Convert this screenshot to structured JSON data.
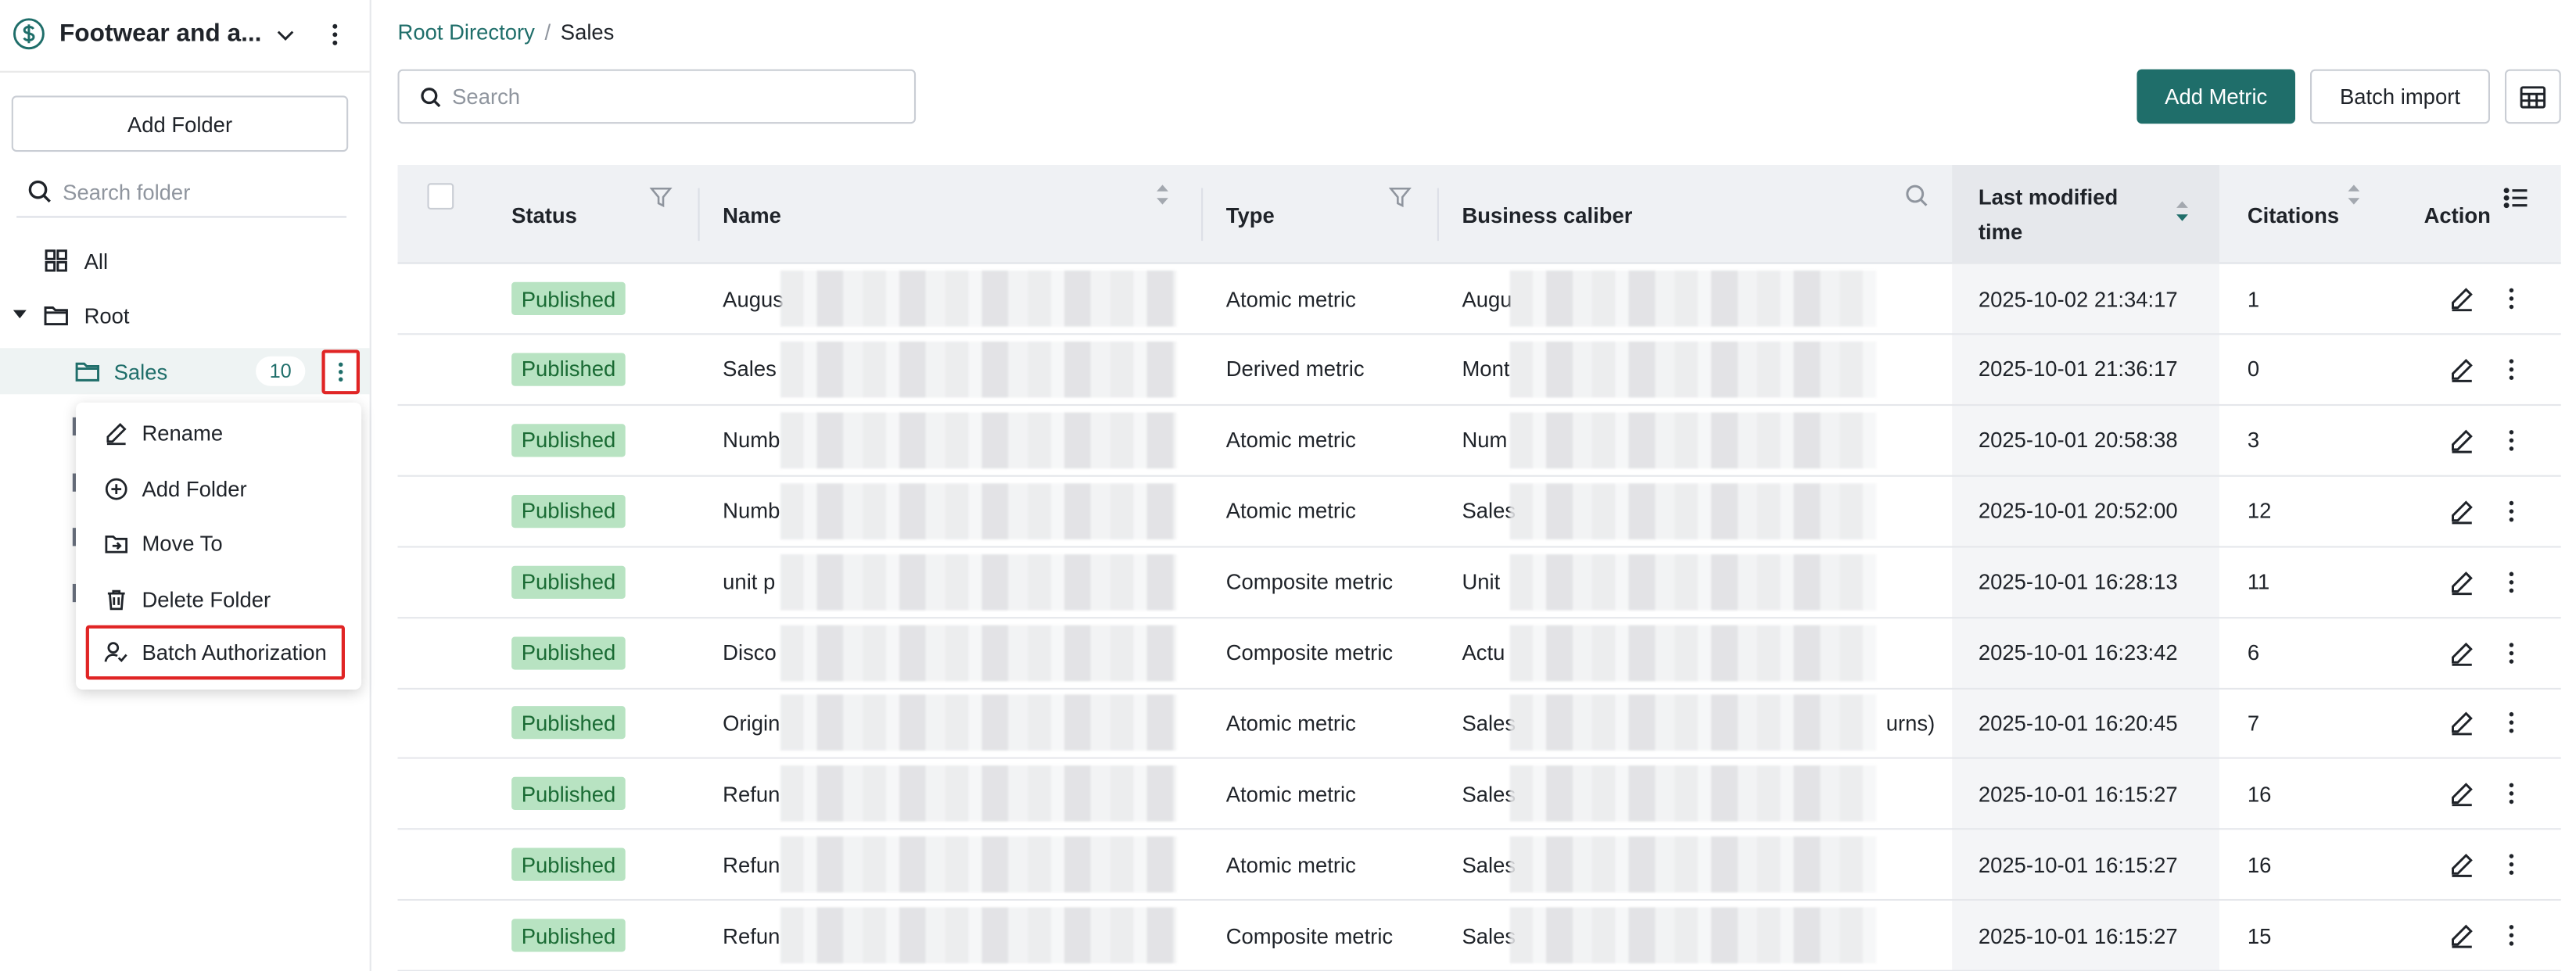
{
  "sidebar": {
    "workspace_title": "Footwear and a...",
    "add_folder_label": "Add Folder",
    "search_placeholder": "Search folder",
    "tree": {
      "all_label": "All",
      "root_label": "Root",
      "sales_label": "Sales",
      "sales_count": "10"
    },
    "context_menu": {
      "rename": "Rename",
      "add_folder": "Add Folder",
      "move_to": "Move To",
      "delete_folder": "Delete Folder",
      "batch_authorization": "Batch Authorization"
    }
  },
  "breadcrumb": {
    "root": "Root Directory",
    "separator": "/",
    "current": "Sales"
  },
  "toolbar": {
    "search_placeholder": "Search",
    "add_metric_label": "Add Metric",
    "batch_import_label": "Batch import"
  },
  "table": {
    "headers": {
      "status": "Status",
      "name": "Name",
      "type": "Type",
      "business_caliber": "Business caliber",
      "last_modified_line1": "Last modified",
      "last_modified_line2": "time",
      "citations": "Citations",
      "action": "Action"
    },
    "rows": [
      {
        "status": "Published",
        "name": "Augus",
        "type": "Atomic metric",
        "caliber": "Augu",
        "modified": "2025-10-02 21:34:17",
        "citations": "1"
      },
      {
        "status": "Published",
        "name": "Sales",
        "type": "Derived metric",
        "caliber": "Mont",
        "modified": "2025-10-01 21:36:17",
        "citations": "0"
      },
      {
        "status": "Published",
        "name": "Numb",
        "type": "Atomic metric",
        "caliber": "Num",
        "modified": "2025-10-01 20:58:38",
        "citations": "3"
      },
      {
        "status": "Published",
        "name": "Numb",
        "type": "Atomic metric",
        "caliber": "Sales",
        "modified": "2025-10-01 20:52:00",
        "citations": "12"
      },
      {
        "status": "Published",
        "name": "unit p",
        "type": "Composite metric",
        "caliber": "Unit",
        "modified": "2025-10-01 16:28:13",
        "citations": "11"
      },
      {
        "status": "Published",
        "name": "Disco",
        "type": "Composite metric",
        "caliber": "Actu",
        "modified": "2025-10-01 16:23:42",
        "citations": "6"
      },
      {
        "status": "Published",
        "name": "Origin",
        "type": "Atomic metric",
        "caliber": "Sales",
        "caliber_tail": "urns)",
        "modified": "2025-10-01 16:20:45",
        "citations": "7"
      },
      {
        "status": "Published",
        "name": "Refun",
        "type": "Atomic metric",
        "caliber": "Sales",
        "modified": "2025-10-01 16:15:27",
        "citations": "16"
      },
      {
        "status": "Published",
        "name": "Refun",
        "type": "Atomic metric",
        "caliber": "Sales",
        "modified": "2025-10-01 16:15:27",
        "citations": "16"
      },
      {
        "status": "Published",
        "name": "Refun",
        "type": "Composite metric",
        "caliber": "Sales",
        "modified": "2025-10-01 16:15:27",
        "citations": "15"
      }
    ]
  },
  "colors": {
    "accent": "#1f6e6a",
    "status_bg": "#b8e3c2",
    "status_text": "#1a6b34",
    "highlight_border": "#e02424"
  },
  "icons": {
    "workspace": "dollar-circle-icon",
    "all": "grid-icon",
    "root": "folder-icon",
    "sales": "folder-icon",
    "filter": "filter-icon",
    "sort": "sort-icon",
    "search": "search-icon",
    "edit": "edit-icon",
    "more": "more-vertical-icon",
    "table_view": "table-icon",
    "action_columns": "list-icon"
  }
}
